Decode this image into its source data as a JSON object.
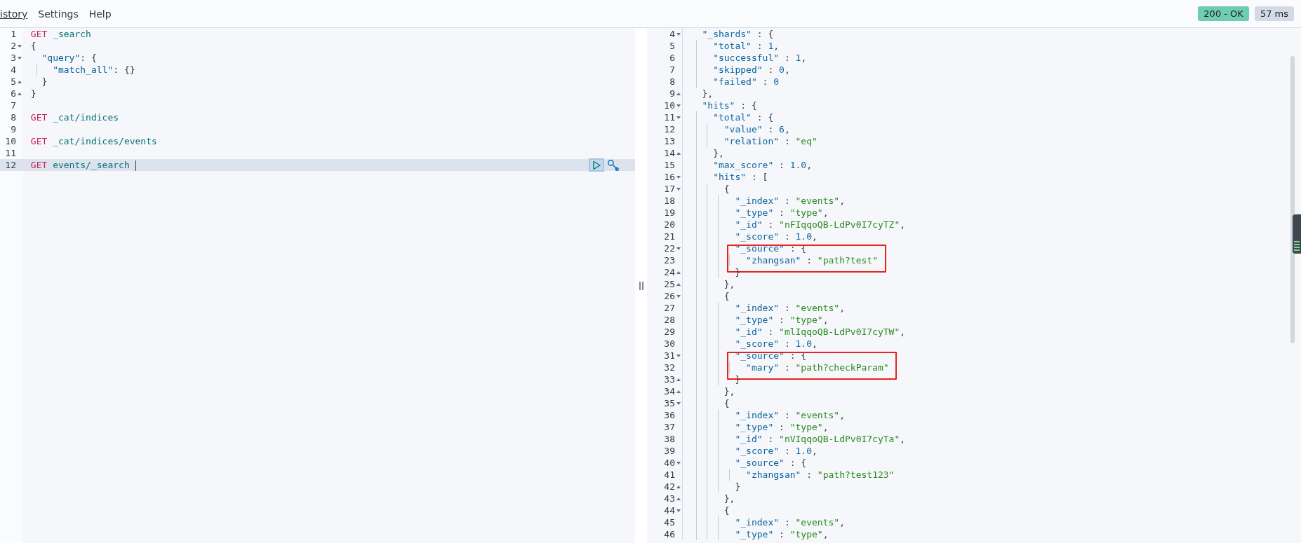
{
  "menu": [
    {
      "label": "istory",
      "underlined": true
    },
    {
      "label": "Settings",
      "underlined": false
    },
    {
      "label": "Help",
      "underlined": false
    }
  ],
  "status": {
    "code": "200 - OK",
    "time": "57 ms"
  },
  "request_editor": {
    "lines": [
      {
        "number": "1",
        "active": false,
        "tokens": [
          {
            "kind": "method",
            "text": "GET"
          },
          {
            "kind": "path",
            "text": " _search"
          }
        ]
      },
      {
        "number": "2",
        "active": false,
        "fold_marker": {
          "kind": "open"
        },
        "tokens": [
          {
            "kind": "punct",
            "text": "{"
          }
        ]
      },
      {
        "number": "3",
        "active": false,
        "fold_marker": {
          "kind": "open"
        },
        "tokens": [
          {
            "kind": "key",
            "text": "  \"query\""
          },
          {
            "kind": "punct",
            "text": ": {"
          }
        ]
      },
      {
        "number": "4",
        "active": false,
        "tokens": [
          {
            "kind": "key",
            "text": "    \"match_all\""
          },
          {
            "kind": "punct",
            "text": ": {}"
          }
        ]
      },
      {
        "number": "5",
        "active": false,
        "fold_marker": {
          "kind": "close"
        },
        "tokens": [
          {
            "kind": "punct",
            "text": "  }"
          }
        ]
      },
      {
        "number": "6",
        "active": false,
        "fold_marker": {
          "kind": "close"
        },
        "tokens": [
          {
            "kind": "punct",
            "text": "}"
          }
        ]
      },
      {
        "number": "7",
        "active": false
      },
      {
        "number": "8",
        "active": false,
        "tokens": [
          {
            "kind": "method",
            "text": "GET"
          },
          {
            "kind": "path",
            "text": " _cat/indices"
          }
        ]
      },
      {
        "number": "9",
        "active": false
      },
      {
        "number": "10",
        "active": false,
        "tokens": [
          {
            "kind": "method",
            "text": "GET"
          },
          {
            "kind": "path",
            "text": " _cat/indices/events"
          }
        ]
      },
      {
        "number": "11",
        "active": false
      },
      {
        "number": "12",
        "active": true,
        "tokens": [
          {
            "kind": "method",
            "text": "GET"
          },
          {
            "kind": "path",
            "text": " events/_search"
          }
        ]
      }
    ]
  },
  "response": {
    "lines": [
      {
        "number": "4",
        "boxed": false,
        "fold_marker": {
          "kind": "open"
        },
        "tokens": [
          {
            "kind": "key",
            "text": "  \"_shards\""
          },
          {
            "kind": "punct",
            "text": " : {"
          }
        ]
      },
      {
        "number": "5",
        "boxed": false,
        "tokens": [
          {
            "kind": "key",
            "text": "    \"total\""
          },
          {
            "kind": "punct",
            "text": " : "
          },
          {
            "kind": "number",
            "text": "1"
          },
          {
            "kind": "punct",
            "text": ","
          }
        ]
      },
      {
        "number": "6",
        "boxed": false,
        "tokens": [
          {
            "kind": "key",
            "text": "    \"successful\""
          },
          {
            "kind": "punct",
            "text": " : "
          },
          {
            "kind": "number",
            "text": "1"
          },
          {
            "kind": "punct",
            "text": ","
          }
        ]
      },
      {
        "number": "7",
        "boxed": false,
        "tokens": [
          {
            "kind": "key",
            "text": "    \"skipped\""
          },
          {
            "kind": "punct",
            "text": " : "
          },
          {
            "kind": "number",
            "text": "0"
          },
          {
            "kind": "punct",
            "text": ","
          }
        ]
      },
      {
        "number": "8",
        "boxed": false,
        "tokens": [
          {
            "kind": "key",
            "text": "    \"failed\""
          },
          {
            "kind": "punct",
            "text": " : "
          },
          {
            "kind": "number",
            "text": "0"
          }
        ]
      },
      {
        "number": "9",
        "boxed": false,
        "fold_marker": {
          "kind": "close"
        },
        "tokens": [
          {
            "kind": "punct",
            "text": "  },"
          }
        ]
      },
      {
        "number": "10",
        "boxed": false,
        "fold_marker": {
          "kind": "open"
        },
        "tokens": [
          {
            "kind": "key",
            "text": "  \"hits\""
          },
          {
            "kind": "punct",
            "text": " : {"
          }
        ]
      },
      {
        "number": "11",
        "boxed": false,
        "fold_marker": {
          "kind": "open"
        },
        "tokens": [
          {
            "kind": "key",
            "text": "    \"total\""
          },
          {
            "kind": "punct",
            "text": " : {"
          }
        ]
      },
      {
        "number": "12",
        "boxed": false,
        "tokens": [
          {
            "kind": "key",
            "text": "      \"value\""
          },
          {
            "kind": "punct",
            "text": " : "
          },
          {
            "kind": "number",
            "text": "6"
          },
          {
            "kind": "punct",
            "text": ","
          }
        ]
      },
      {
        "number": "13",
        "boxed": false,
        "tokens": [
          {
            "kind": "key",
            "text": "      \"relation\""
          },
          {
            "kind": "punct",
            "text": " : "
          },
          {
            "kind": "string",
            "text": "\"eq\""
          }
        ]
      },
      {
        "number": "14",
        "boxed": false,
        "fold_marker": {
          "kind": "close"
        },
        "tokens": [
          {
            "kind": "punct",
            "text": "    },"
          }
        ]
      },
      {
        "number": "15",
        "boxed": false,
        "tokens": [
          {
            "kind": "key",
            "text": "    \"max_score\""
          },
          {
            "kind": "punct",
            "text": " : "
          },
          {
            "kind": "number",
            "text": "1.0"
          },
          {
            "kind": "punct",
            "text": ","
          }
        ]
      },
      {
        "number": "16",
        "boxed": false,
        "fold_marker": {
          "kind": "open"
        },
        "tokens": [
          {
            "kind": "key",
            "text": "    \"hits\""
          },
          {
            "kind": "punct",
            "text": " : ["
          }
        ]
      },
      {
        "number": "17",
        "boxed": false,
        "fold_marker": {
          "kind": "open"
        },
        "tokens": [
          {
            "kind": "punct",
            "text": "      {"
          }
        ]
      },
      {
        "number": "18",
        "boxed": false,
        "tokens": [
          {
            "kind": "key",
            "text": "        \"_index\""
          },
          {
            "kind": "punct",
            "text": " : "
          },
          {
            "kind": "string",
            "text": "\"events\""
          },
          {
            "kind": "punct",
            "text": ","
          }
        ]
      },
      {
        "number": "19",
        "boxed": false,
        "tokens": [
          {
            "kind": "key",
            "text": "        \"_type\""
          },
          {
            "kind": "punct",
            "text": " : "
          },
          {
            "kind": "string",
            "text": "\"type\""
          },
          {
            "kind": "punct",
            "text": ","
          }
        ]
      },
      {
        "number": "20",
        "boxed": false,
        "tokens": [
          {
            "kind": "key",
            "text": "        \"_id\""
          },
          {
            "kind": "punct",
            "text": " : "
          },
          {
            "kind": "string",
            "text": "\"nFIqqoQB-LdPv0I7cyTZ\""
          },
          {
            "kind": "punct",
            "text": ","
          }
        ]
      },
      {
        "number": "21",
        "boxed": false,
        "tokens": [
          {
            "kind": "key",
            "text": "        \"_score\""
          },
          {
            "kind": "punct",
            "text": " : "
          },
          {
            "kind": "number",
            "text": "1.0"
          },
          {
            "kind": "punct",
            "text": ","
          }
        ]
      },
      {
        "number": "22",
        "boxed": false,
        "fold_marker": {
          "kind": "open"
        },
        "tokens": [
          {
            "kind": "key",
            "text": "        \"_source\""
          },
          {
            "kind": "punct",
            "text": " : {"
          }
        ]
      },
      {
        "number": "23",
        "boxed": true,
        "tokens": [
          {
            "kind": "key",
            "text": "          \"zhangsan\""
          },
          {
            "kind": "punct",
            "text": " : "
          },
          {
            "kind": "string",
            "text": "\"path?test\""
          }
        ]
      },
      {
        "number": "24",
        "boxed": false,
        "fold_marker": {
          "kind": "close"
        },
        "tokens": [
          {
            "kind": "punct",
            "text": "        }"
          }
        ]
      },
      {
        "number": "25",
        "boxed": false,
        "fold_marker": {
          "kind": "close"
        },
        "tokens": [
          {
            "kind": "punct",
            "text": "      },"
          }
        ]
      },
      {
        "number": "26",
        "boxed": false,
        "fold_marker": {
          "kind": "open"
        },
        "tokens": [
          {
            "kind": "punct",
            "text": "      {"
          }
        ]
      },
      {
        "number": "27",
        "boxed": false,
        "tokens": [
          {
            "kind": "key",
            "text": "        \"_index\""
          },
          {
            "kind": "punct",
            "text": " : "
          },
          {
            "kind": "string",
            "text": "\"events\""
          },
          {
            "kind": "punct",
            "text": ","
          }
        ]
      },
      {
        "number": "28",
        "boxed": false,
        "tokens": [
          {
            "kind": "key",
            "text": "        \"_type\""
          },
          {
            "kind": "punct",
            "text": " : "
          },
          {
            "kind": "string",
            "text": "\"type\""
          },
          {
            "kind": "punct",
            "text": ","
          }
        ]
      },
      {
        "number": "29",
        "boxed": false,
        "tokens": [
          {
            "kind": "key",
            "text": "        \"_id\""
          },
          {
            "kind": "punct",
            "text": " : "
          },
          {
            "kind": "string",
            "text": "\"mlIqqoQB-LdPv0I7cyTW\""
          },
          {
            "kind": "punct",
            "text": ","
          }
        ]
      },
      {
        "number": "30",
        "boxed": false,
        "tokens": [
          {
            "kind": "key",
            "text": "        \"_score\""
          },
          {
            "kind": "punct",
            "text": " : "
          },
          {
            "kind": "number",
            "text": "1.0"
          },
          {
            "kind": "punct",
            "text": ","
          }
        ]
      },
      {
        "number": "31",
        "boxed": false,
        "fold_marker": {
          "kind": "open"
        },
        "tokens": [
          {
            "kind": "key",
            "text": "        \"_source\""
          },
          {
            "kind": "punct",
            "text": " : {"
          }
        ]
      },
      {
        "number": "32",
        "boxed": true,
        "tokens": [
          {
            "kind": "key",
            "text": "          \"mary\""
          },
          {
            "kind": "punct",
            "text": " : "
          },
          {
            "kind": "string",
            "text": "\"path?checkParam\""
          }
        ]
      },
      {
        "number": "33",
        "boxed": false,
        "fold_marker": {
          "kind": "close"
        },
        "tokens": [
          {
            "kind": "punct",
            "text": "        }"
          }
        ]
      },
      {
        "number": "34",
        "boxed": false,
        "fold_marker": {
          "kind": "close"
        },
        "tokens": [
          {
            "kind": "punct",
            "text": "      },"
          }
        ]
      },
      {
        "number": "35",
        "boxed": false,
        "fold_marker": {
          "kind": "open"
        },
        "tokens": [
          {
            "kind": "punct",
            "text": "      {"
          }
        ]
      },
      {
        "number": "36",
        "boxed": false,
        "tokens": [
          {
            "kind": "key",
            "text": "        \"_index\""
          },
          {
            "kind": "punct",
            "text": " : "
          },
          {
            "kind": "string",
            "text": "\"events\""
          },
          {
            "kind": "punct",
            "text": ","
          }
        ]
      },
      {
        "number": "37",
        "boxed": false,
        "tokens": [
          {
            "kind": "key",
            "text": "        \"_type\""
          },
          {
            "kind": "punct",
            "text": " : "
          },
          {
            "kind": "string",
            "text": "\"type\""
          },
          {
            "kind": "punct",
            "text": ","
          }
        ]
      },
      {
        "number": "38",
        "boxed": false,
        "tokens": [
          {
            "kind": "key",
            "text": "        \"_id\""
          },
          {
            "kind": "punct",
            "text": " : "
          },
          {
            "kind": "string",
            "text": "\"nVIqqoQB-LdPv0I7cyTa\""
          },
          {
            "kind": "punct",
            "text": ","
          }
        ]
      },
      {
        "number": "39",
        "boxed": false,
        "tokens": [
          {
            "kind": "key",
            "text": "        \"_score\""
          },
          {
            "kind": "punct",
            "text": " : "
          },
          {
            "kind": "number",
            "text": "1.0"
          },
          {
            "kind": "punct",
            "text": ","
          }
        ]
      },
      {
        "number": "40",
        "boxed": false,
        "fold_marker": {
          "kind": "open"
        },
        "tokens": [
          {
            "kind": "key",
            "text": "        \"_source\""
          },
          {
            "kind": "punct",
            "text": " : {"
          }
        ]
      },
      {
        "number": "41",
        "boxed": false,
        "tokens": [
          {
            "kind": "key",
            "text": "          \"zhangsan\""
          },
          {
            "kind": "punct",
            "text": " : "
          },
          {
            "kind": "string",
            "text": "\"path?test123\""
          }
        ]
      },
      {
        "number": "42",
        "boxed": false,
        "fold_marker": {
          "kind": "close"
        },
        "tokens": [
          {
            "kind": "punct",
            "text": "        }"
          }
        ]
      },
      {
        "number": "43",
        "boxed": false,
        "fold_marker": {
          "kind": "close"
        },
        "tokens": [
          {
            "kind": "punct",
            "text": "      },"
          }
        ]
      },
      {
        "number": "44",
        "boxed": false,
        "fold_marker": {
          "kind": "open"
        },
        "tokens": [
          {
            "kind": "punct",
            "text": "      {"
          }
        ]
      },
      {
        "number": "45",
        "boxed": false,
        "tokens": [
          {
            "kind": "key",
            "text": "        \"_index\""
          },
          {
            "kind": "punct",
            "text": " : "
          },
          {
            "kind": "string",
            "text": "\"events\""
          },
          {
            "kind": "punct",
            "text": ","
          }
        ]
      },
      {
        "number": "46",
        "boxed": false,
        "tokens": [
          {
            "kind": "key",
            "text": "        \"_type\""
          },
          {
            "kind": "punct",
            "text": " : "
          },
          {
            "kind": "string",
            "text": "\"type\""
          },
          {
            "kind": "punct",
            "text": ","
          }
        ]
      }
    ]
  }
}
